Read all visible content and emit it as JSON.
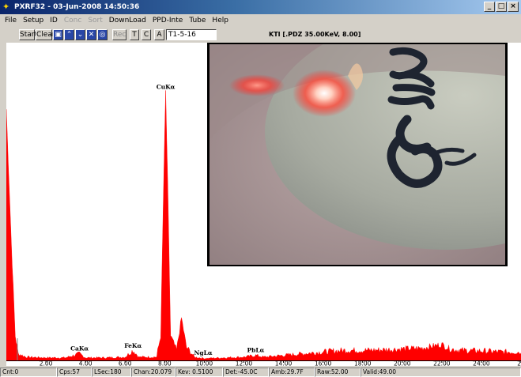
{
  "window": {
    "title": "PXRF32 - 03-Jun-2008 14:50:36"
  },
  "window_buttons": {
    "minimize": "_",
    "maximize": "□",
    "close": "×"
  },
  "menu": [
    "File",
    "Setup",
    "ID",
    "Conc",
    "Sort",
    "DownLoad",
    "PPD-Inte",
    "Tube",
    "Help"
  ],
  "menu_disabled": [
    false,
    false,
    false,
    true,
    true,
    false,
    false,
    false,
    false
  ],
  "toolbar": {
    "start": "Start",
    "clear": "Clear",
    "rec": "Rec",
    "t": "T",
    "c": "C",
    "a": "A",
    "sample_id": "T1-5-16",
    "status": "KTI  [.PDZ 35.00KeV, 8.00]"
  },
  "statusbar": [
    "Cnt:0",
    "Cps:57",
    "LSec:180",
    "Chan:20.079",
    "Kev: 0.5100",
    "Det:-45.0C",
    "Amb:29.7F",
    "Raw:52.00",
    "Valid:49.00"
  ],
  "chart_data": {
    "type": "line",
    "xlim": [
      0,
      26
    ],
    "ylim": [
      0,
      100
    ],
    "x_ticks": [
      2,
      4,
      6,
      8,
      10,
      12,
      14,
      16,
      18,
      20,
      22,
      24,
      26
    ],
    "x_tick_labels": [
      "2.00",
      "4.00",
      "6.00",
      "8.00",
      "10.00",
      "12.00",
      "14.00",
      "16.00",
      "18.00",
      "20.00",
      "22.00",
      "24.00",
      "26"
    ],
    "peaks": [
      {
        "label": "CaKα",
        "x": 3.7,
        "y": 2
      },
      {
        "label": "FeKα",
        "x": 6.4,
        "y": 3
      },
      {
        "label": "CuKα",
        "x": 8.05,
        "y": 91
      },
      {
        "label": "NgLα",
        "x": 9.95,
        "y": 0.5
      },
      {
        "label": "PbLα",
        "x": 12.6,
        "y": 1.5
      }
    ],
    "series": [
      {
        "color": "#ff0000",
        "points": [
          [
            0,
            85
          ],
          [
            0.25,
            40
          ],
          [
            0.45,
            8
          ],
          [
            0.6,
            2
          ],
          [
            1,
            1
          ],
          [
            2,
            0.8
          ],
          [
            3,
            0.8
          ],
          [
            3.7,
            2
          ],
          [
            4,
            0.8
          ],
          [
            5,
            0.8
          ],
          [
            6,
            1
          ],
          [
            6.4,
            3
          ],
          [
            6.7,
            1
          ],
          [
            7.6,
            1
          ],
          [
            7.8,
            8
          ],
          [
            7.95,
            60
          ],
          [
            8.05,
            91
          ],
          [
            8.15,
            60
          ],
          [
            8.3,
            8
          ],
          [
            8.6,
            3
          ],
          [
            8.85,
            14
          ],
          [
            9.1,
            4
          ],
          [
            9.5,
            1
          ],
          [
            10,
            0.6
          ],
          [
            11,
            0.8
          ],
          [
            12,
            1
          ],
          [
            12.6,
            1.5
          ],
          [
            13,
            1
          ],
          [
            14,
            1.5
          ],
          [
            15,
            2
          ],
          [
            16,
            2.5
          ],
          [
            17,
            3
          ],
          [
            18,
            3
          ],
          [
            19,
            3.2
          ],
          [
            20,
            3.5
          ],
          [
            21,
            3.8
          ],
          [
            22,
            5
          ],
          [
            22.4,
            3.5
          ],
          [
            23,
            3
          ],
          [
            24,
            2.8
          ],
          [
            25,
            2.5
          ],
          [
            26,
            2.5
          ]
        ]
      }
    ]
  }
}
